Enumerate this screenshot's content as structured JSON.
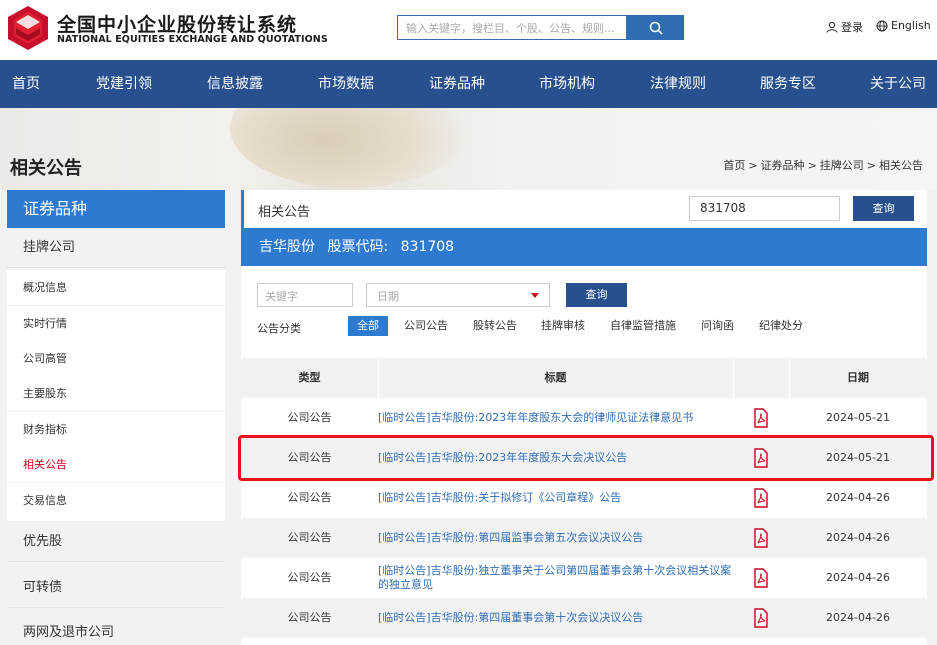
{
  "header": {
    "logo_cn": "全国中小企业股份转让系统",
    "logo_en": "NATIONAL EQUITIES EXCHANGE AND QUOTATIONS",
    "search_placeholder": "输入关键字，搜栏目、个股、公告、规则...",
    "login": "登录",
    "english": "English"
  },
  "nav": [
    "首页",
    "党建引领",
    "信息披露",
    "市场数据",
    "证券品种",
    "市场机构",
    "法律规则",
    "服务专区",
    "关于公司"
  ],
  "page": {
    "title": "相关公告",
    "breadcrumb": [
      "首页",
      "证券品种",
      "挂牌公司",
      "相关公告"
    ]
  },
  "sidebar": {
    "head": "证券品种",
    "categories": [
      "挂牌公司",
      "优先股",
      "可转债",
      "两网及退市公司"
    ],
    "sub_items": [
      "概况信息",
      "实时行情",
      "公司高管",
      "主要股东",
      "财务指标",
      "相关公告",
      "交易信息"
    ],
    "active_sub": "相关公告"
  },
  "main": {
    "header_title": "相关公告",
    "code_input_value": "831708",
    "query_label": "查询",
    "stock_name": "吉华股份",
    "stock_code_label": "股票代码:",
    "stock_code": "831708",
    "keyword_placeholder": "关键字",
    "date_placeholder": "日期",
    "category_label": "公告分类",
    "categories": [
      "全部",
      "公司公告",
      "股转公告",
      "挂牌审核",
      "自律监管措施",
      "问询函",
      "纪律处分"
    ],
    "active_category": "全部"
  },
  "table": {
    "headers": {
      "type": "类型",
      "title": "标题",
      "date": "日期"
    },
    "rows": [
      {
        "type": "公司公告",
        "title": "[临时公告]吉华股份:2023年年度股东大会的律师见证法律意见书",
        "date": "2024-05-21"
      },
      {
        "type": "公司公告",
        "title": "[临时公告]吉华股份:2023年年度股东大会决议公告",
        "date": "2024-05-21"
      },
      {
        "type": "公司公告",
        "title": "[临时公告]吉华股份:关于拟修订《公司章程》公告",
        "date": "2024-04-26"
      },
      {
        "type": "公司公告",
        "title": "[临时公告]吉华股份:第四届监事会第五次会议决议公告",
        "date": "2024-04-26"
      },
      {
        "type": "公司公告",
        "title": "[临时公告]吉华股份:独立董事关于公司第四届董事会第十次会议相关议案的独立意见",
        "date": "2024-04-26"
      },
      {
        "type": "公司公告",
        "title": "[临时公告]吉华股份:第四届董事会第十次会议决议公告",
        "date": "2024-04-26"
      }
    ],
    "highlighted_row": 1
  },
  "colors": {
    "nav_bg": "#28508f",
    "accent_blue": "#2e7ad1",
    "active_red": "#d0021b",
    "highlight_red": "#e8141b",
    "link_blue": "#2e6db4"
  }
}
